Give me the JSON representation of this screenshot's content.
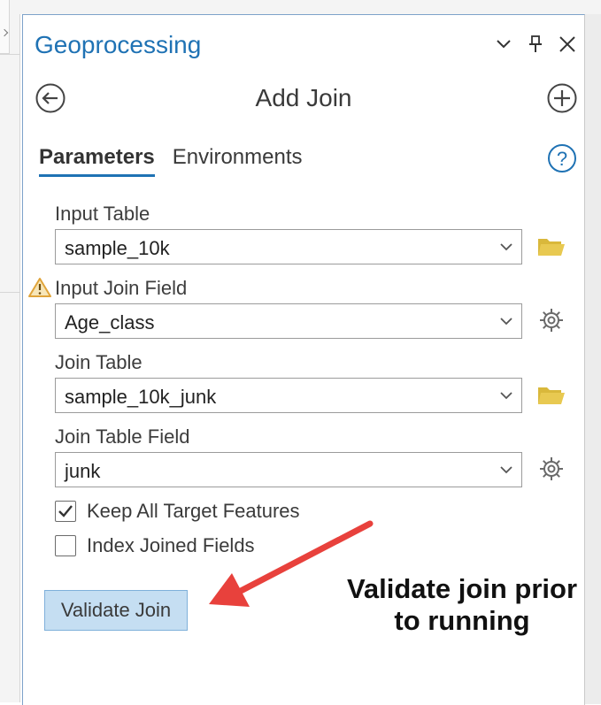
{
  "pane": {
    "title": "Geoprocessing",
    "tool_name": "Add Join"
  },
  "tabs": [
    {
      "label": "Parameters",
      "active": true
    },
    {
      "label": "Environments",
      "active": false
    }
  ],
  "fields": {
    "input_table": {
      "label": "Input Table",
      "value": "sample_10k",
      "side_icon": "folder-icon"
    },
    "input_join_field": {
      "label": "Input Join Field",
      "value": "Age_class",
      "warning": true,
      "side_icon": "gear-icon"
    },
    "join_table": {
      "label": "Join Table",
      "value": "sample_10k_junk",
      "side_icon": "folder-icon"
    },
    "join_table_field": {
      "label": "Join Table Field",
      "value": "junk",
      "side_icon": "gear-icon"
    }
  },
  "options": {
    "keep_all": {
      "label": "Keep All Target Features",
      "checked": true
    },
    "index_joined": {
      "label": "Index Joined Fields",
      "checked": false
    }
  },
  "validate_button": {
    "label": "Validate Join"
  },
  "annotation": {
    "line1": "Validate join prior",
    "line2": "to running",
    "arrow_color": "#e8413c"
  },
  "colors": {
    "accent": "#1f72b4",
    "folder": "#d9b83b",
    "warning": "#e0a43a",
    "button_bg": "#c5def2"
  }
}
